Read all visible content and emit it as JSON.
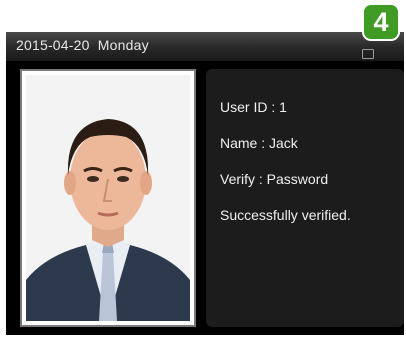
{
  "status_bar": {
    "datetime": "2015-04-20  Monday",
    "status_icon": "battery-icon"
  },
  "step_badge": "4",
  "photo": {
    "icon": "user-photo"
  },
  "info": {
    "user_id": "User ID : 1",
    "name": "Name : Jack",
    "verify": "Verify : Password",
    "result": "Successfully verified."
  }
}
